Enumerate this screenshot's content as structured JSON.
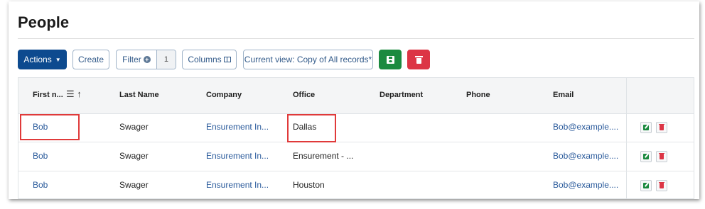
{
  "page": {
    "title": "People"
  },
  "toolbar": {
    "actions_label": "Actions",
    "create_label": "Create",
    "filter_label": "Filter",
    "filter_count": "1",
    "columns_label": "Columns",
    "view_label": "Current view: Copy of All records*"
  },
  "table": {
    "columns": [
      "First n...",
      "Last Name",
      "Company",
      "Office",
      "Department",
      "Phone",
      "Email"
    ],
    "rows": [
      {
        "first": "Bob",
        "last": "Swager",
        "company": "Ensurement In...",
        "office": "Dallas",
        "department": "",
        "phone": "",
        "email": "Bob@example...."
      },
      {
        "first": "Bob",
        "last": "Swager",
        "company": "Ensurement In...",
        "office": "Ensurement - ...",
        "department": "",
        "phone": "",
        "email": "Bob@example...."
      },
      {
        "first": "Bob",
        "last": "Swager",
        "company": "Ensurement In...",
        "office": "Houston",
        "department": "",
        "phone": "",
        "email": "Bob@example...."
      }
    ]
  },
  "colors": {
    "primary": "#0d4a8f",
    "success": "#1b8a3f",
    "danger": "#dc3545",
    "link": "#2a5a9b",
    "highlight": "#e03a3a"
  }
}
